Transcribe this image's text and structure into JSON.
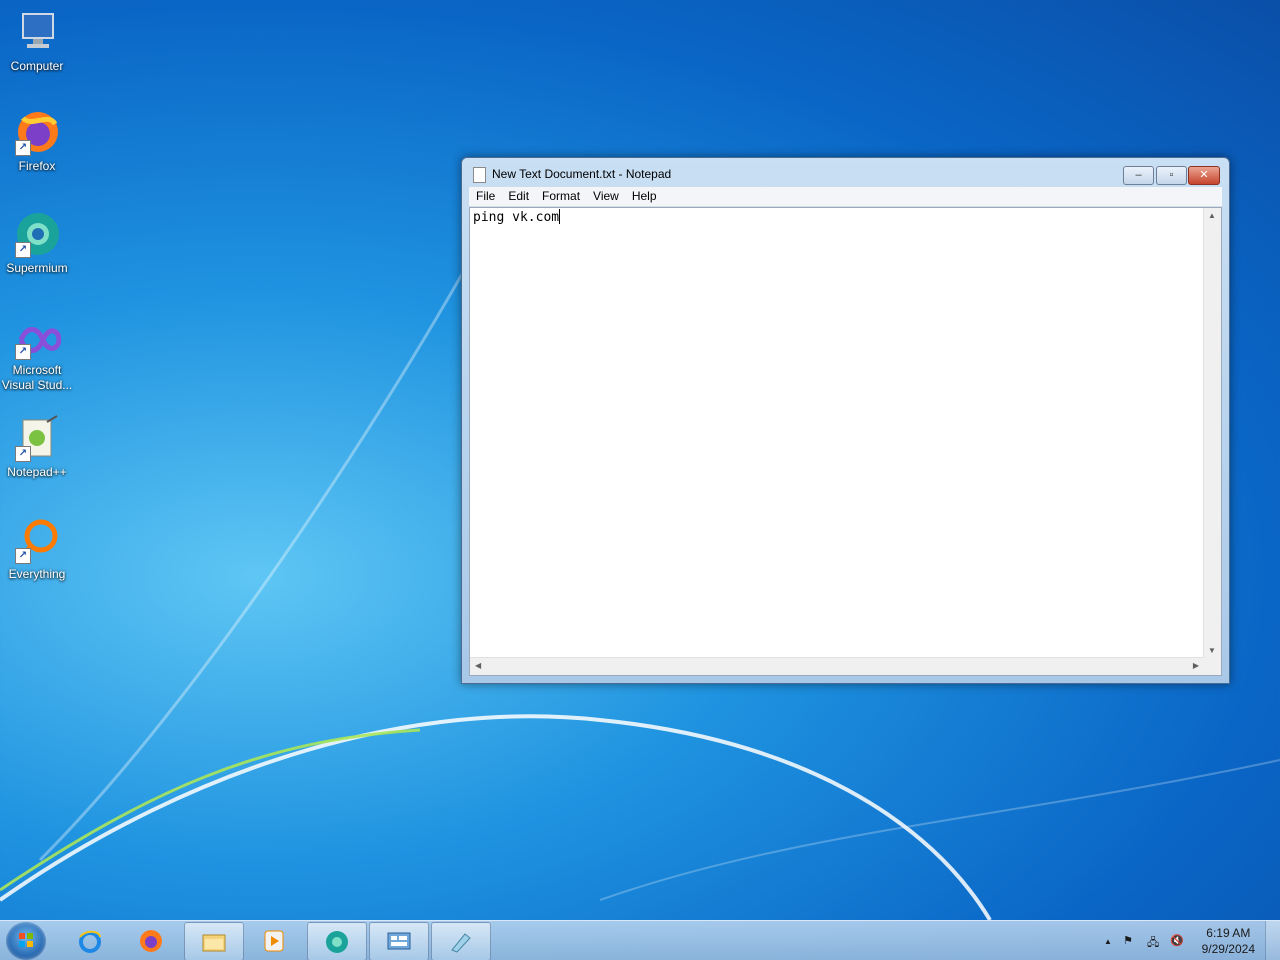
{
  "desktop": {
    "icons": [
      {
        "label": "Computer"
      },
      {
        "label": "Firefox"
      },
      {
        "label": "Supermium"
      },
      {
        "label": "Microsoft Visual Stud..."
      },
      {
        "label": "Notepad++"
      },
      {
        "label": "Everything"
      }
    ]
  },
  "window": {
    "title": "New Text Document.txt - Notepad",
    "menu": [
      "File",
      "Edit",
      "Format",
      "View",
      "Help"
    ],
    "content": "ping vk.com"
  },
  "taskbar": {
    "apps": [
      {
        "icon": "internet-explorer-icon"
      },
      {
        "icon": "firefox-icon"
      },
      {
        "icon": "file-explorer-icon"
      },
      {
        "icon": "media-player-icon"
      },
      {
        "icon": "supermium-icon"
      },
      {
        "icon": "control-panel-icon"
      },
      {
        "icon": "notepad-icon"
      }
    ],
    "clock": {
      "time": "6:19 AM",
      "date": "9/29/2024"
    },
    "tray_arrow": "▲"
  }
}
